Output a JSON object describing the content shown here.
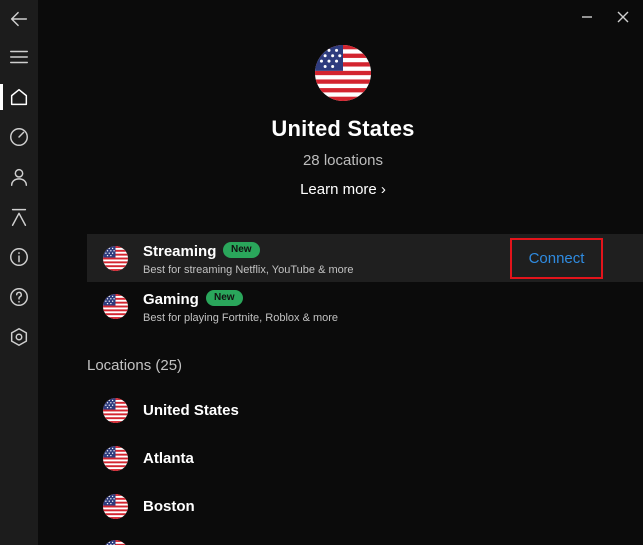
{
  "colors": {
    "background": "#0b0b0b",
    "sidebar": "#1c1c1c",
    "highlight_row": "#1f1f1f",
    "new_badge": "#2aa65b",
    "connect_text": "#2f8be0",
    "connect_outline": "#e3141b"
  },
  "window_controls": {
    "minimize_icon": "minimize-icon",
    "close_icon": "close-icon"
  },
  "sidebar": {
    "items": [
      {
        "name": "back",
        "icon": "arrow-left-icon"
      },
      {
        "name": "menu",
        "icon": "hamburger-menu-icon"
      },
      {
        "name": "home",
        "icon": "home-icon",
        "active": true
      },
      {
        "name": "speed",
        "icon": "speedometer-icon"
      },
      {
        "name": "account",
        "icon": "person-icon"
      },
      {
        "name": "split-tunneling",
        "icon": "lambda-icon"
      },
      {
        "name": "info",
        "icon": "info-icon"
      },
      {
        "name": "help",
        "icon": "help-icon"
      },
      {
        "name": "settings",
        "icon": "settings-hexagon-icon"
      }
    ]
  },
  "country": {
    "flag": "us-flag-icon",
    "title": "United States",
    "locations_count": "28 locations",
    "learn_more": "Learn more ›"
  },
  "servers": [
    {
      "name": "Streaming",
      "badge": "New",
      "description": "Best for streaming Netflix, YouTube & more",
      "highlighted": true,
      "flag": "us-flag-icon"
    },
    {
      "name": "Gaming",
      "badge": "New",
      "description": "Best for playing Fortnite, Roblox & more",
      "highlighted": false,
      "flag": "us-flag-icon"
    }
  ],
  "connect_label": "Connect",
  "locations_heading": "Locations (25)",
  "locations": [
    {
      "name": "United States",
      "flag": "us-flag-icon"
    },
    {
      "name": "Atlanta",
      "flag": "us-flag-icon"
    },
    {
      "name": "Boston",
      "flag": "us-flag-icon"
    }
  ]
}
